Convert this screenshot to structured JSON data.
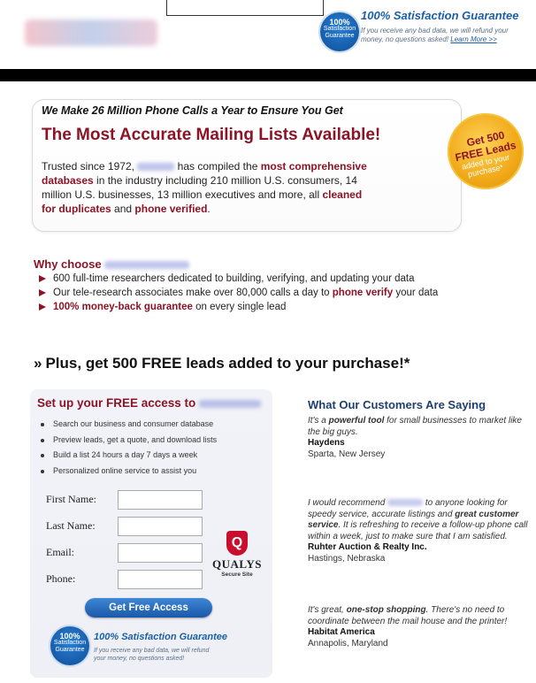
{
  "header": {
    "guarantee_title": "100% Satisfaction Guarantee",
    "guarantee_text_1": "If you receive any bad data, we will refund your",
    "guarantee_text_2": "money, no questions asked!",
    "learn_more": "Learn More >>",
    "seal_line1": "100%",
    "seal_line2": "Satisfaction",
    "seal_line3": "Guarantee"
  },
  "hero": {
    "subtitle": "We Make 26 Million Phone Calls a Year to Ensure You Get",
    "title": "The Most Accurate Mailing Lists Available!",
    "body_1": "Trusted since 1972,",
    "body_2": "has compiled the",
    "body_3": "most comprehensive databases",
    "body_4": "in the industry including 210 million U.S. consumers, 14 million U.S. businesses, 13 million executives and more, all",
    "body_5": "cleaned for duplicates",
    "body_6": "and",
    "body_7": "phone verified",
    "body_8": ".",
    "badge_l1": "Get 500",
    "badge_l2": "FREE Leads",
    "badge_l3": "added to your",
    "badge_l4": "purchase*"
  },
  "why": {
    "title": "Why choose",
    "items": [
      {
        "text": "600 full-time researchers dedicated to building, verifying, and updating your data"
      },
      {
        "pre": "Our tele-research associates make over 80,000 calls a day to",
        "bold": "phone verify",
        "post": "your data"
      },
      {
        "bold": "100% money-back guarantee",
        "post": "on every single lead"
      }
    ]
  },
  "plus": {
    "chevron": "»",
    "text": "Plus, get 500 FREE leads added to your purchase!*"
  },
  "form": {
    "title": "Set up your FREE access to",
    "bullets": [
      "Search our business and consumer database",
      "Preview leads, get a quote, and download lists",
      "Build a list 24 hours a day 7 days a week",
      "Personalized online service to assist you"
    ],
    "first_name_label": "First Name:",
    "last_name_label": "Last Name:",
    "email_label": "Email:",
    "phone_label": "Phone:",
    "first_name_value": "",
    "last_name_value": "",
    "email_value": "",
    "phone_value": "",
    "submit_label": "Get Free Access",
    "qualys_letter": "Q",
    "qualys_name": "QUALYS",
    "qualys_sub": "Secure Site",
    "guarantee_title": "100% Satisfaction Guarantee",
    "guarantee_text_1": "If you receive any bad data, we will refund",
    "guarantee_text_2": "your money, no questions asked!"
  },
  "testimonials": {
    "title": "What Our Customers Are Saying",
    "items": [
      {
        "q_pre": "It's a",
        "q_bold": "powerful tool",
        "q_post": "for small businesses to market like the big guys.",
        "name": "Haydens",
        "place": "Sparta, New Jersey"
      },
      {
        "q_pre": "I would recommend",
        "q_mid": "to anyone looking for speedy service, accurate listings and",
        "q_bold": "great customer service",
        "q_post": ". It is refreshing to receive a follow-up phone call within a week, just to make sure that I am satisfied.",
        "name": "Ruhter Auction & Realty Inc.",
        "place": "Hastings, Nebraska"
      },
      {
        "q_pre": "It's great,",
        "q_bold": "one-stop shopping",
        "q_post": ". There's no need to coordinate between the mail house and the printer!",
        "name": "Habitat America",
        "place": "Annapolis, Maryland"
      }
    ]
  },
  "colors": {
    "accent_red": "#8b1426",
    "link_blue": "#1b5fa8",
    "badge_gold": "#f0a817"
  }
}
